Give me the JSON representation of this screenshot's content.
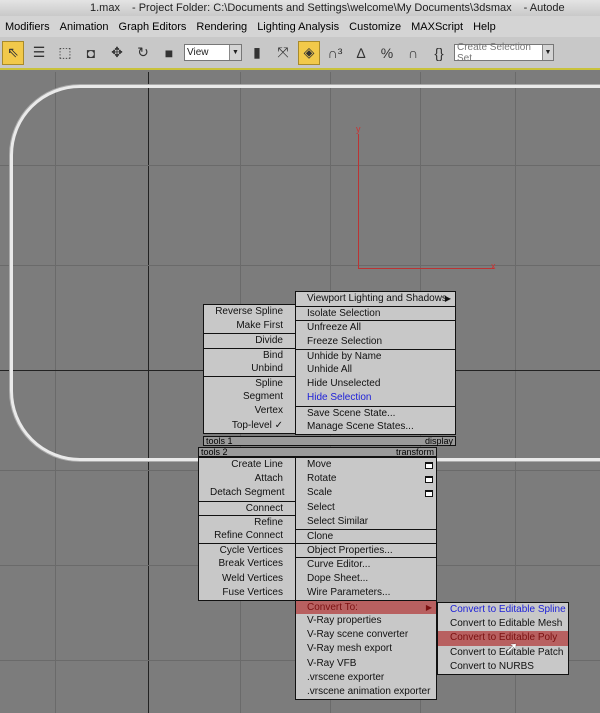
{
  "title": {
    "file": "1.max",
    "project": "- Project Folder: C:\\Documents and Settings\\welcome\\My Documents\\3dsmax",
    "app": "- Autode"
  },
  "menu": [
    "Modifiers",
    "Animation",
    "Graph Editors",
    "Rendering",
    "Lighting Analysis",
    "Customize",
    "MAXScript",
    "Help"
  ],
  "toolbar": {
    "view_select": "View",
    "selection_set_placeholder": "Create Selection Set"
  },
  "viewport": {
    "axis_y": "y",
    "axis_x": "x",
    "axis_color": "#b33333"
  },
  "quad": {
    "tools1_label": "tools 1",
    "display_label": "display",
    "tools2_label": "tools 2",
    "transform_label": "transform",
    "tools1": [
      [
        "Reverse Spline",
        "Make First"
      ],
      [
        "Divide"
      ],
      [
        "Bind",
        "Unbind"
      ],
      [
        "Spline",
        "Segment",
        "Vertex",
        "Top-level ✓"
      ]
    ],
    "display": [
      [
        "Viewport Lighting and Shadows"
      ],
      [
        "Isolate Selection"
      ],
      [
        "Unfreeze All",
        "Freeze Selection"
      ],
      [
        "Unhide by Name",
        "Unhide All",
        "Hide Unselected",
        "Hide Selection"
      ],
      [
        "Save Scene State...",
        "Manage Scene States..."
      ]
    ],
    "tools2": [
      [
        "Create Line",
        "Attach",
        "Detach Segment"
      ],
      [
        "Connect"
      ],
      [
        "Refine",
        "Refine Connect"
      ],
      [
        "Cycle Vertices",
        "Break Vertices",
        "Weld Vertices",
        "Fuse Vertices"
      ]
    ],
    "transform": [
      [
        "Move",
        "Rotate",
        "Scale",
        "Select",
        "Select Similar"
      ],
      [
        "Clone"
      ],
      [
        "Object Properties..."
      ],
      [
        "Curve Editor...",
        "Dope Sheet...",
        "Wire Parameters..."
      ],
      [
        "Convert To:",
        "V-Ray properties",
        "V-Ray scene converter",
        "V-Ray mesh export",
        "V-Ray VFB",
        ".vrscene exporter",
        ".vrscene animation exporter"
      ]
    ],
    "convert_submenu": [
      "Convert to Editable Spline",
      "Convert to Editable Mesh",
      "Convert to Editable Poly",
      "Convert to Editable Patch",
      "Convert to NURBS"
    ],
    "highlight_color": "#b86060"
  }
}
